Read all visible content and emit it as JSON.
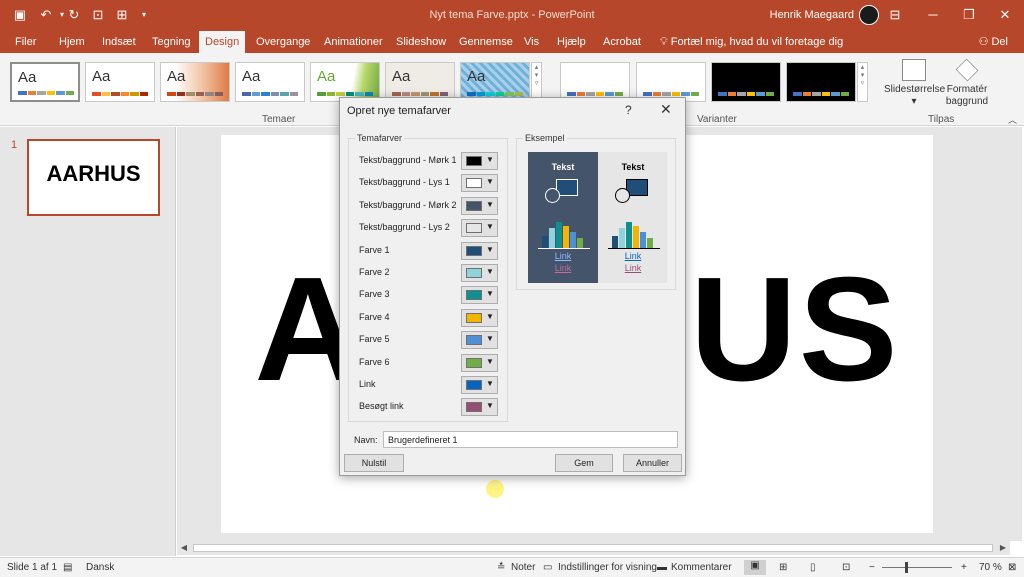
{
  "app": {
    "doc_title": "Nyt tema Farve.pptx  -  PowerPoint",
    "user_name": "Henrik Maegaard"
  },
  "tabs": [
    "Filer",
    "Hjem",
    "Indsæt",
    "Tegning",
    "Design",
    "Overgange",
    "Animationer",
    "Slideshow",
    "Gennemse",
    "Vis",
    "Hjælp",
    "Acrobat"
  ],
  "active_tab": "Design",
  "tell_me": "Fortæl mig, hvad du vil foretage dig",
  "share": "Del",
  "ribbon": {
    "group_temaer": "Temaer",
    "group_varianter": "Varianter",
    "group_tilpas": "Tilpas",
    "theme_sample": "Aa",
    "slide_size_label": "Slidestørrelse",
    "format_bg_label_1": "Formatér",
    "format_bg_label_2": "baggrund"
  },
  "slides_pane": {
    "slide_number": "1",
    "thumb_title": "AARHUS"
  },
  "slide": {
    "title": "AARHUS"
  },
  "dialog": {
    "title": "Opret nye temafarver",
    "help": "?",
    "close": "✕",
    "group_colors": "Temafarver",
    "group_preview": "Eksempel",
    "rows": [
      {
        "label": "Tekst/baggrund - Mørk 1",
        "color": "#000000"
      },
      {
        "label": "Tekst/baggrund - Lys 1",
        "color": "#ffffff"
      },
      {
        "label": "Tekst/baggrund - Mørk 2",
        "color": "#44546a"
      },
      {
        "label": "Tekst/baggrund - Lys 2",
        "color": "#e7e6e6"
      },
      {
        "label": "Farve 1",
        "color": "#1f4e79"
      },
      {
        "label": "Farve 2",
        "color": "#8fd4dd"
      },
      {
        "label": "Farve 3",
        "color": "#0f8f8f"
      },
      {
        "label": "Farve 4",
        "color": "#f2b600"
      },
      {
        "label": "Farve 5",
        "color": "#4f8fd6"
      },
      {
        "label": "Farve 6",
        "color": "#70ad47"
      },
      {
        "label": "Link",
        "color": "#0563c1"
      },
      {
        "label": "Besøgt link",
        "color": "#954f72"
      }
    ],
    "preview": {
      "text": "Tekst",
      "link": "Link",
      "visited_link": "Link"
    },
    "name_label": "Navn:",
    "name_value": "Brugerdefineret 1",
    "reset_button": "Nulstil",
    "save_button": "Gem",
    "cancel_button": "Annuller"
  },
  "status": {
    "slide_of": "Slide 1 af 1",
    "language": "Dansk",
    "notes": "Noter",
    "display_settings": "Indstillinger for visning",
    "comments": "Kommentarer",
    "zoom": "70 %"
  }
}
